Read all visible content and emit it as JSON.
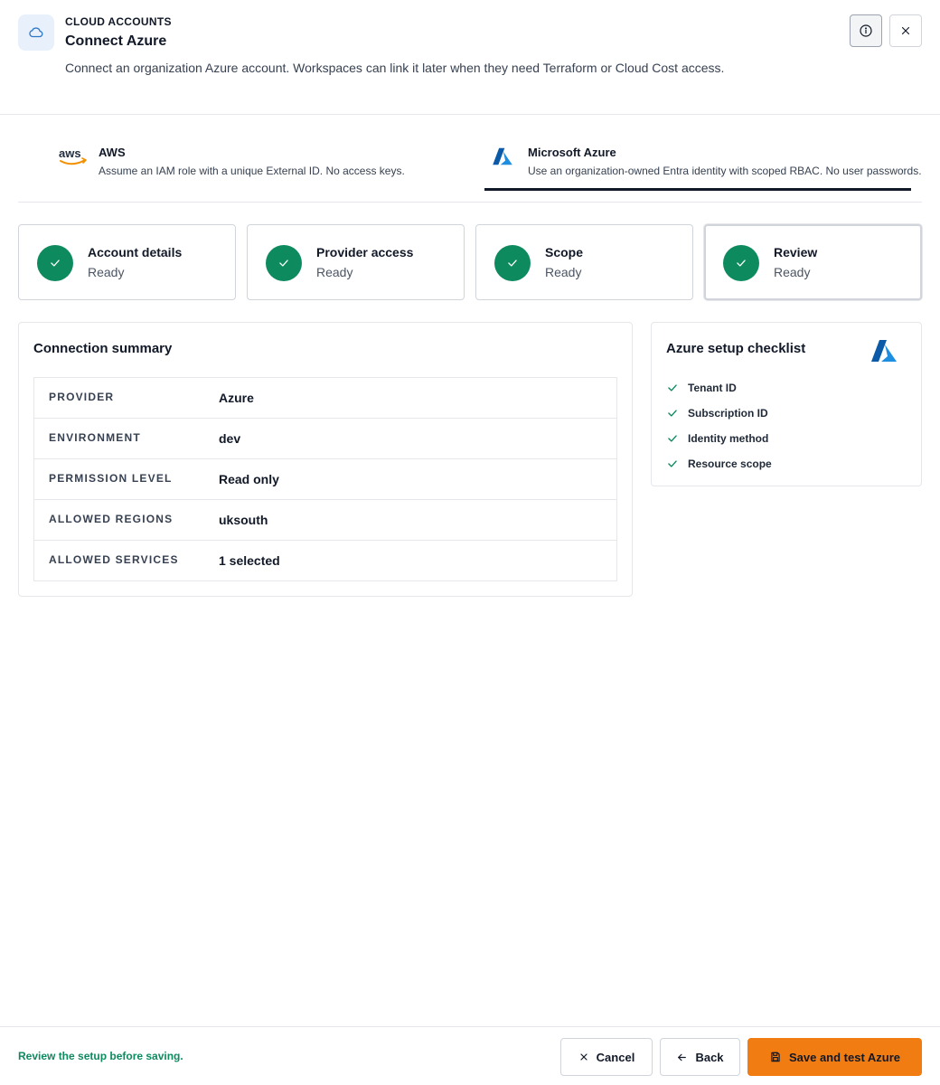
{
  "header": {
    "eyebrow": "CLOUD ACCOUNTS",
    "title": "Connect Azure",
    "description": "Connect an organization Azure account. Workspaces can link it later when they need Terraform or Cloud Cost access.",
    "icon": "cloud-icon",
    "info_icon": "info-icon",
    "close_icon": "close-icon"
  },
  "providers": [
    {
      "logo_text": "aws",
      "name": "AWS",
      "description": "Assume an IAM role with a unique External ID. No access keys.",
      "selected": false
    },
    {
      "name": "Microsoft Azure",
      "description": "Use an organization-owned Entra identity with scoped RBAC. No user passwords.",
      "selected": true
    }
  ],
  "steps": [
    {
      "title": "Account details",
      "status": "Ready"
    },
    {
      "title": "Provider access",
      "status": "Ready"
    },
    {
      "title": "Scope",
      "status": "Ready"
    },
    {
      "title": "Review",
      "status": "Ready"
    }
  ],
  "summary": {
    "title": "Connection summary",
    "rows": [
      {
        "key": "PROVIDER",
        "value": "Azure"
      },
      {
        "key": "ENVIRONMENT",
        "value": "dev"
      },
      {
        "key": "PERMISSION LEVEL",
        "value": "Read only"
      },
      {
        "key": "ALLOWED REGIONS",
        "value": "uksouth"
      },
      {
        "key": "ALLOWED SERVICES",
        "value": "1 selected"
      }
    ]
  },
  "checklist": {
    "title": "Azure setup checklist",
    "items": [
      "Tenant ID",
      "Subscription ID",
      "Identity method",
      "Resource scope"
    ]
  },
  "footer": {
    "message": "Review the setup before saving.",
    "cancel_label": "Cancel",
    "back_label": "Back",
    "save_label": "Save and test Azure"
  },
  "colors": {
    "accent": "#f07c12",
    "success": "#0e8a5f",
    "azure": "#0078d4"
  }
}
